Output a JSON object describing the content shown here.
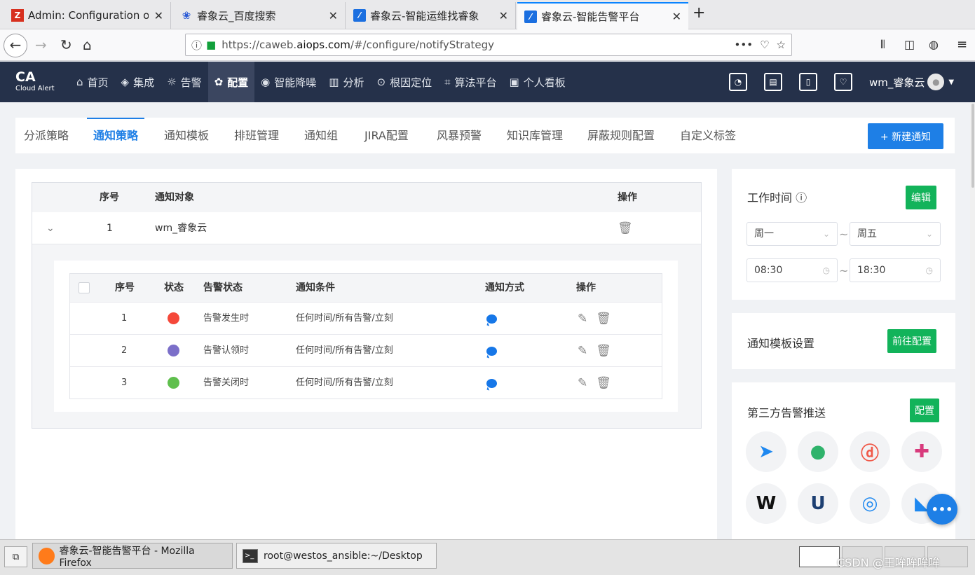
{
  "browser": {
    "tabs": [
      {
        "label": "Admin: Configuration of h",
        "favicon": "zabbix-icon"
      },
      {
        "label": "睿象云_百度搜索",
        "favicon": "baidu-paw-icon"
      },
      {
        "label": "睿象云-智能运维找睿象",
        "favicon": "ca-icon"
      },
      {
        "label": "睿象云-智能告警平台",
        "favicon": "ca-icon"
      }
    ],
    "url_prefix": "https://caweb.",
    "url_domain": "aiops.com",
    "url_path": "/#/configure/notifyStrategy",
    "url_menu": "•••"
  },
  "app": {
    "logo_main": "CA",
    "logo_sub": "Cloud Alert",
    "menu": [
      {
        "label": "首页",
        "icon": "home-icon",
        "glyph": "⌂"
      },
      {
        "label": "集成",
        "icon": "layers-icon",
        "glyph": "◈"
      },
      {
        "label": "告警",
        "icon": "alarm-icon",
        "glyph": "☼"
      },
      {
        "label": "配置",
        "icon": "gears-icon",
        "glyph": "✿"
      },
      {
        "label": "智能降噪",
        "icon": "noise-icon",
        "glyph": "◉"
      },
      {
        "label": "分析",
        "icon": "chart-icon",
        "glyph": "▥"
      },
      {
        "label": "根因定位",
        "icon": "target-icon",
        "glyph": "⊙"
      },
      {
        "label": "算法平台",
        "icon": "algorithm-icon",
        "glyph": "⌗"
      },
      {
        "label": "个人看板",
        "icon": "dashboard-icon",
        "glyph": "▣"
      }
    ],
    "username": "wm_睿象云"
  },
  "subtabs": [
    "分派策略",
    "通知策略",
    "通知模板",
    "排班管理",
    "通知组",
    "JIRA配置",
    "风暴预警",
    "知识库管理",
    "屏蔽规则配置",
    "自定义标签"
  ],
  "new_notify_button": "+ 新建通知",
  "outer_table": {
    "headers": {
      "seq": "序号",
      "target": "通知对象",
      "ops": "操作"
    },
    "row": {
      "seq": "1",
      "target": "wm_睿象云"
    }
  },
  "inner_table": {
    "headers": {
      "seq": "序号",
      "status": "状态",
      "alert_status": "告警状态",
      "condition": "通知条件",
      "method": "通知方式",
      "ops": "操作"
    },
    "rows": [
      {
        "seq": "1",
        "color": "#f5483a",
        "alert_status": "告警发生时",
        "condition": "任何时间/所有告警/立刻"
      },
      {
        "seq": "2",
        "color": "#7b6fc9",
        "alert_status": "告警认领时",
        "condition": "任何时间/所有告警/立刻"
      },
      {
        "seq": "3",
        "color": "#5fbf4d",
        "alert_status": "告警关闭时",
        "condition": "任何时间/所有告警/立刻"
      }
    ]
  },
  "work_time": {
    "title": "工作时间",
    "edit_button": "编辑",
    "day_from": "周一",
    "day_to": "周五",
    "time_from": "08:30",
    "time_to": "18:30"
  },
  "template_settings": {
    "title": "通知模板设置",
    "button": "前往配置"
  },
  "third_party": {
    "title": "第三方告警推送",
    "button": "配置",
    "logos": [
      {
        "name": "dingtalk-icon",
        "glyph": "➤",
        "color": "#1e88f0"
      },
      {
        "name": "bear-icon",
        "glyph": "●",
        "color": "#2fb36b"
      },
      {
        "name": "pagerduty-icon",
        "glyph": "ⓓ",
        "color": "#f05a4a"
      },
      {
        "name": "slack-icon",
        "glyph": "✚",
        "color": "#d83a7c"
      },
      {
        "name": "wordpress-icon",
        "glyph": "W",
        "color": "#111111"
      },
      {
        "name": "shield-u-icon",
        "glyph": "U",
        "color": "#1d3f72"
      },
      {
        "name": "chat-bubble-icon",
        "glyph": "◎",
        "color": "#1e88f0"
      },
      {
        "name": "feishu-icon",
        "glyph": "◣",
        "color": "#1e88f0"
      }
    ]
  },
  "taskbar": {
    "firefox_task": "睿象云-智能告警平台 - Mozilla Firefox",
    "terminal_task": "root@westos_ansible:~/Desktop"
  },
  "watermark": "CSDN @王哞哞哞哞"
}
